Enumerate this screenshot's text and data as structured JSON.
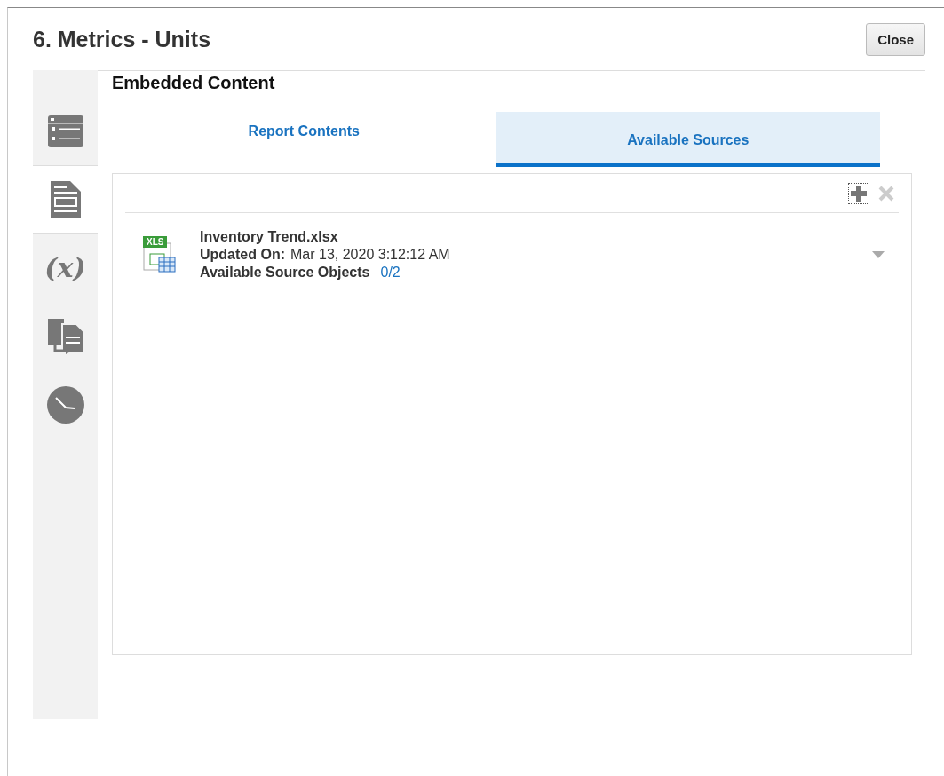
{
  "dialog": {
    "title": "6. Metrics - Units",
    "close_button": "Close"
  },
  "sidebar": {
    "items": [
      {
        "kind": "list",
        "selected": false
      },
      {
        "kind": "document",
        "selected": true
      },
      {
        "kind": "variable",
        "glyph": "(x)",
        "selected": false
      },
      {
        "kind": "transfer",
        "selected": false
      },
      {
        "kind": "clock",
        "selected": false
      }
    ]
  },
  "section_title": "Embedded Content",
  "tabs": [
    {
      "label": "Report Contents",
      "selected": false
    },
    {
      "label": "Available Sources",
      "selected": true
    }
  ],
  "toolbar": {
    "add_disabled": false,
    "remove_disabled": true
  },
  "sources": [
    {
      "badge": "XLS",
      "name": "Inventory Trend.xlsx",
      "updated_label": "Updated On:",
      "updated_value": "Mar 13, 2020 3:12:12 AM",
      "objects_label": "Available Source Objects",
      "objects_value": "0/2"
    }
  ]
}
